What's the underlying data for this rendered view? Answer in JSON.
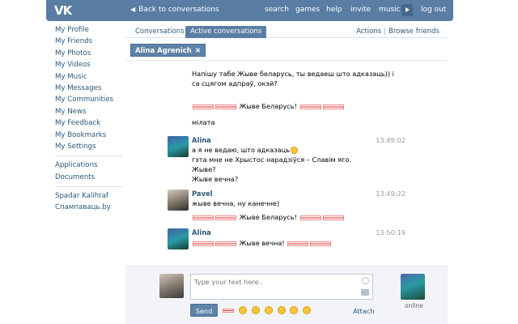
{
  "header": {
    "logo": "VK",
    "back": "Back to conversations",
    "nav": [
      "search",
      "games",
      "help",
      "invite",
      "music"
    ],
    "logout": "log out"
  },
  "sidebar": {
    "items": [
      "My Profile",
      "My Friends",
      "My Photos",
      "My Videos",
      "My Music",
      "My Messages",
      "My Communities",
      "My News",
      "My Feedback",
      "My Bookmarks",
      "My Settings"
    ],
    "apps": [
      "Applications",
      "Documents"
    ],
    "links": [
      "Spadar Kalihraf",
      "Спампаваць.by"
    ]
  },
  "tabs": {
    "conversations": "Conversations",
    "active": "Active conversations",
    "actions": "Actions",
    "browse": "Browse friends",
    "chip": "Alina Agrenich"
  },
  "messages": {
    "l0": "Напішу табе Жыве беларусь, ты ведаеш што адказаць)) і",
    "l1": "са сцягом адпраў, окэй?",
    "l2": " Жыве Беларусь! ",
    "l3": "мілата",
    "m1": {
      "name": "Alina",
      "time": "13:49:02",
      "lines": [
        "а я не ведаю, што адказаць",
        "гэта мне не Хрыстос нарадзіўся – Славім яго.",
        "Жыве?",
        "Жыве вечна?"
      ]
    },
    "m2": {
      "name": "Pavel",
      "time": "13:49:22",
      "lines": [
        "жыве вечна, ну канечне)",
        " Жыве Беларусь! "
      ]
    },
    "m3": {
      "name": "Alina",
      "time": "13:50:19",
      "lines": [
        " Жыве вечна! "
      ]
    }
  },
  "compose": {
    "placeholder": "Type your text here..",
    "send": "Send",
    "attach": "Attach",
    "online": "online"
  },
  "colors": {
    "brand": "#597da3",
    "link": "#2b587a"
  }
}
